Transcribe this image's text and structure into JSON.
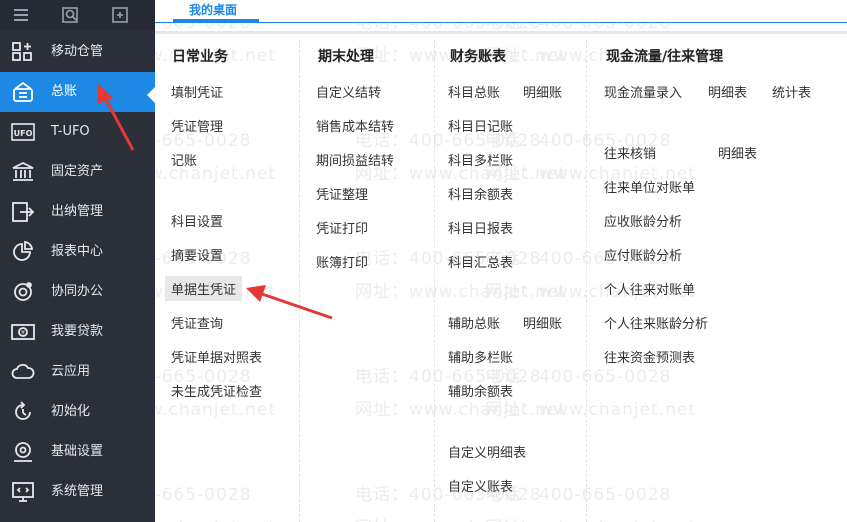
{
  "tab": {
    "label": "我的桌面"
  },
  "sidebar": {
    "items": [
      {
        "label": "移动仓管",
        "icon": "mobile-warehouse-icon"
      },
      {
        "label": "总账",
        "icon": "ledger-icon"
      },
      {
        "label": "T-UFO",
        "icon": "ufo-report-icon"
      },
      {
        "label": "固定资产",
        "icon": "bank-building-icon"
      },
      {
        "label": "出纳管理",
        "icon": "cashier-exit-icon"
      },
      {
        "label": "报表中心",
        "icon": "pie-chart-icon"
      },
      {
        "label": "协同办公",
        "icon": "collaboration-icon"
      },
      {
        "label": "我要贷款",
        "icon": "money-icon"
      },
      {
        "label": "云应用",
        "icon": "cloud-icon"
      },
      {
        "label": "初始化",
        "icon": "refresh-icon"
      },
      {
        "label": "基础设置",
        "icon": "settings-icon"
      },
      {
        "label": "系统管理",
        "icon": "system-monitor-icon"
      }
    ],
    "active_index": 1
  },
  "columns": {
    "daily": {
      "title": "日常业务",
      "items": [
        "填制凭证",
        "凭证管理",
        "记账",
        "科目设置",
        "摘要设置",
        "单据生凭证",
        "凭证查询",
        "凭证单据对照表",
        "未生成凭证检查"
      ]
    },
    "period_end": {
      "title": "期末处理",
      "items": [
        "自定义结转",
        "销售成本结转",
        "期间损益结转",
        "凭证整理",
        "凭证打印",
        "账簿打印"
      ]
    },
    "reports": {
      "title": "财务账表",
      "items": [
        "科目总账",
        "明细账",
        "科目日记账",
        "科目多栏账",
        "科目余额表",
        "科目日报表",
        "科目汇总表",
        "辅助总账",
        "明细账",
        "辅助多栏账",
        "辅助余额表",
        "自定义明细表",
        "自定义账表"
      ]
    },
    "cashflow": {
      "title": "现金流量/往来管理",
      "items": [
        "现金流量录入",
        "明细表",
        "统计表",
        "往来核销",
        "明细表",
        "往来单位对账单",
        "应收账龄分析",
        "应付账龄分析",
        "个人往来对账单",
        "个人往来账龄分析",
        "往来资金预测表"
      ]
    }
  },
  "watermark": {
    "phone": "电话：400-665-0028",
    "site": "网址：www.chanjet.net"
  },
  "colors": {
    "sidebar_bg": "#2b2f3a",
    "accent": "#1e88e5",
    "annotation_arrow": "#e53935"
  }
}
